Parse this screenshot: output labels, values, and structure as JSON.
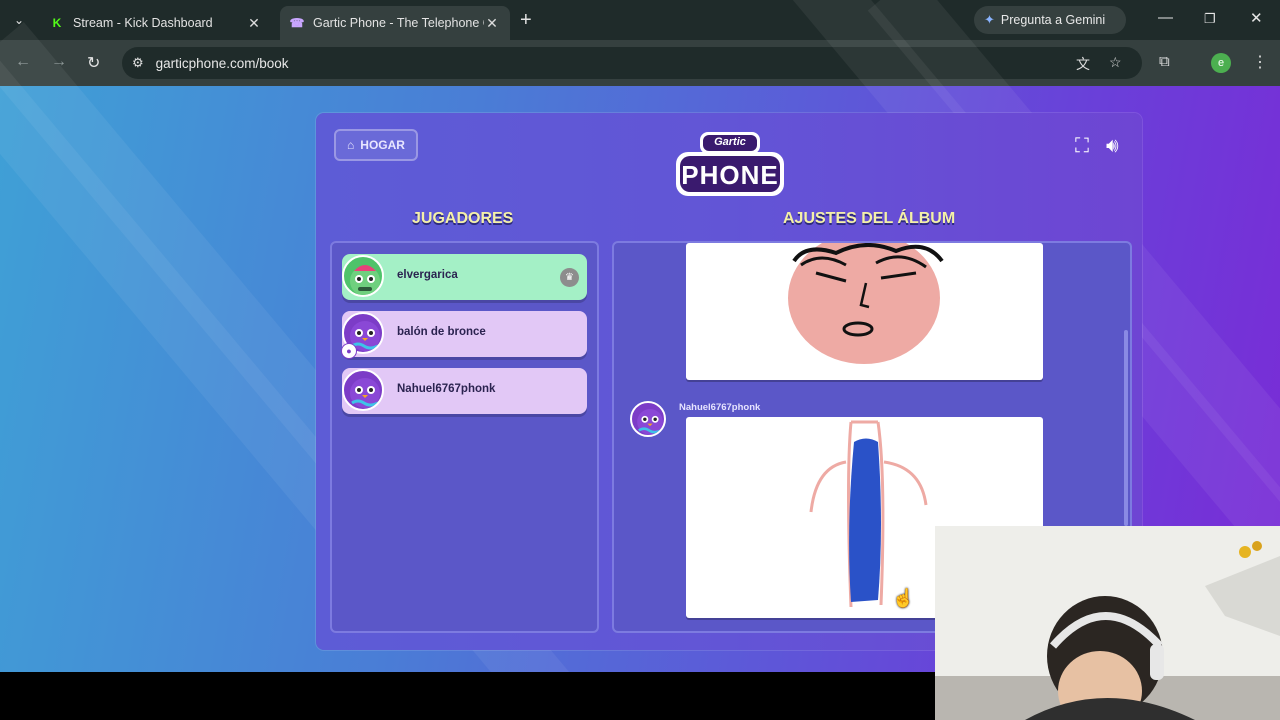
{
  "browser": {
    "tabs": [
      {
        "title": "Stream - Kick Dashboard",
        "icon": "kick-icon"
      },
      {
        "title": "Gartic Phone - The Telephone G",
        "icon": "gartic-icon"
      }
    ],
    "gemini_label": "Pregunta a Gemini",
    "url": "garticphone.com/book",
    "profile_initial": "e"
  },
  "game": {
    "home_label": "HOGAR",
    "logo_top": "Gartic",
    "logo_main": "PHONE",
    "players_heading": "JUGADORES",
    "album_heading": "AJUSTES DEL ÁLBUM",
    "players": [
      {
        "name": "elvergarica",
        "host": true
      },
      {
        "name": "balón de bronce",
        "host": false
      },
      {
        "name": "Nahuel6767phonk",
        "host": false
      }
    ],
    "album_author": "Nahuel6767phonk"
  }
}
